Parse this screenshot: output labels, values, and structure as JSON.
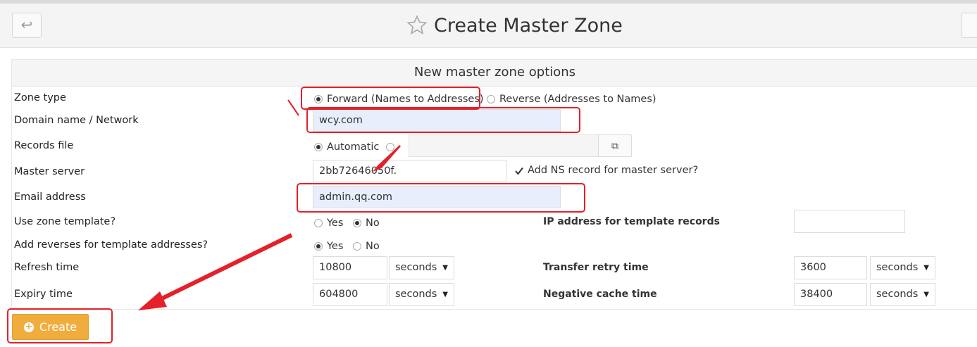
{
  "header": {
    "title": "Create Master Zone",
    "back_icon": "return-arrow-icon",
    "star_icon": "star-outline-icon"
  },
  "panel": {
    "heading": "New master zone options"
  },
  "form": {
    "zone_type": {
      "label": "Zone type",
      "forward": "Forward (Names to Addresses)",
      "reverse": "Reverse (Addresses to Names)",
      "selected": "forward"
    },
    "domain": {
      "label": "Domain name / Network",
      "value": "wcy.com"
    },
    "records_file": {
      "label": "Records file",
      "automatic": "Automatic",
      "selected": "automatic",
      "value": ""
    },
    "master_server": {
      "label": "Master server",
      "value": "2bb72646050f.",
      "ns_label": "Add NS record for master server?",
      "ns_checked": true
    },
    "email": {
      "label": "Email address",
      "value": "admin.qq.com"
    },
    "template": {
      "label": "Use zone template?",
      "yes": "Yes",
      "no": "No",
      "selected": "no"
    },
    "ip_template": {
      "label": "IP address for template records",
      "value": ""
    },
    "reverses": {
      "label": "Add reverses for template addresses?",
      "yes": "Yes",
      "no": "No",
      "selected": "yes"
    },
    "refresh": {
      "label": "Refresh time",
      "value": "10800",
      "unit": "seconds"
    },
    "transfer_retry": {
      "label": "Transfer retry time",
      "value": "3600",
      "unit": "seconds"
    },
    "expiry": {
      "label": "Expiry time",
      "value": "604800",
      "unit": "seconds"
    },
    "negative_cache": {
      "label": "Negative cache time",
      "value": "38400",
      "unit": "seconds"
    }
  },
  "actions": {
    "create_label": "Create"
  },
  "colors": {
    "annotation": "#e4202a",
    "create_button": "#f0ad3e",
    "highlight_field": "#e8eefc"
  }
}
